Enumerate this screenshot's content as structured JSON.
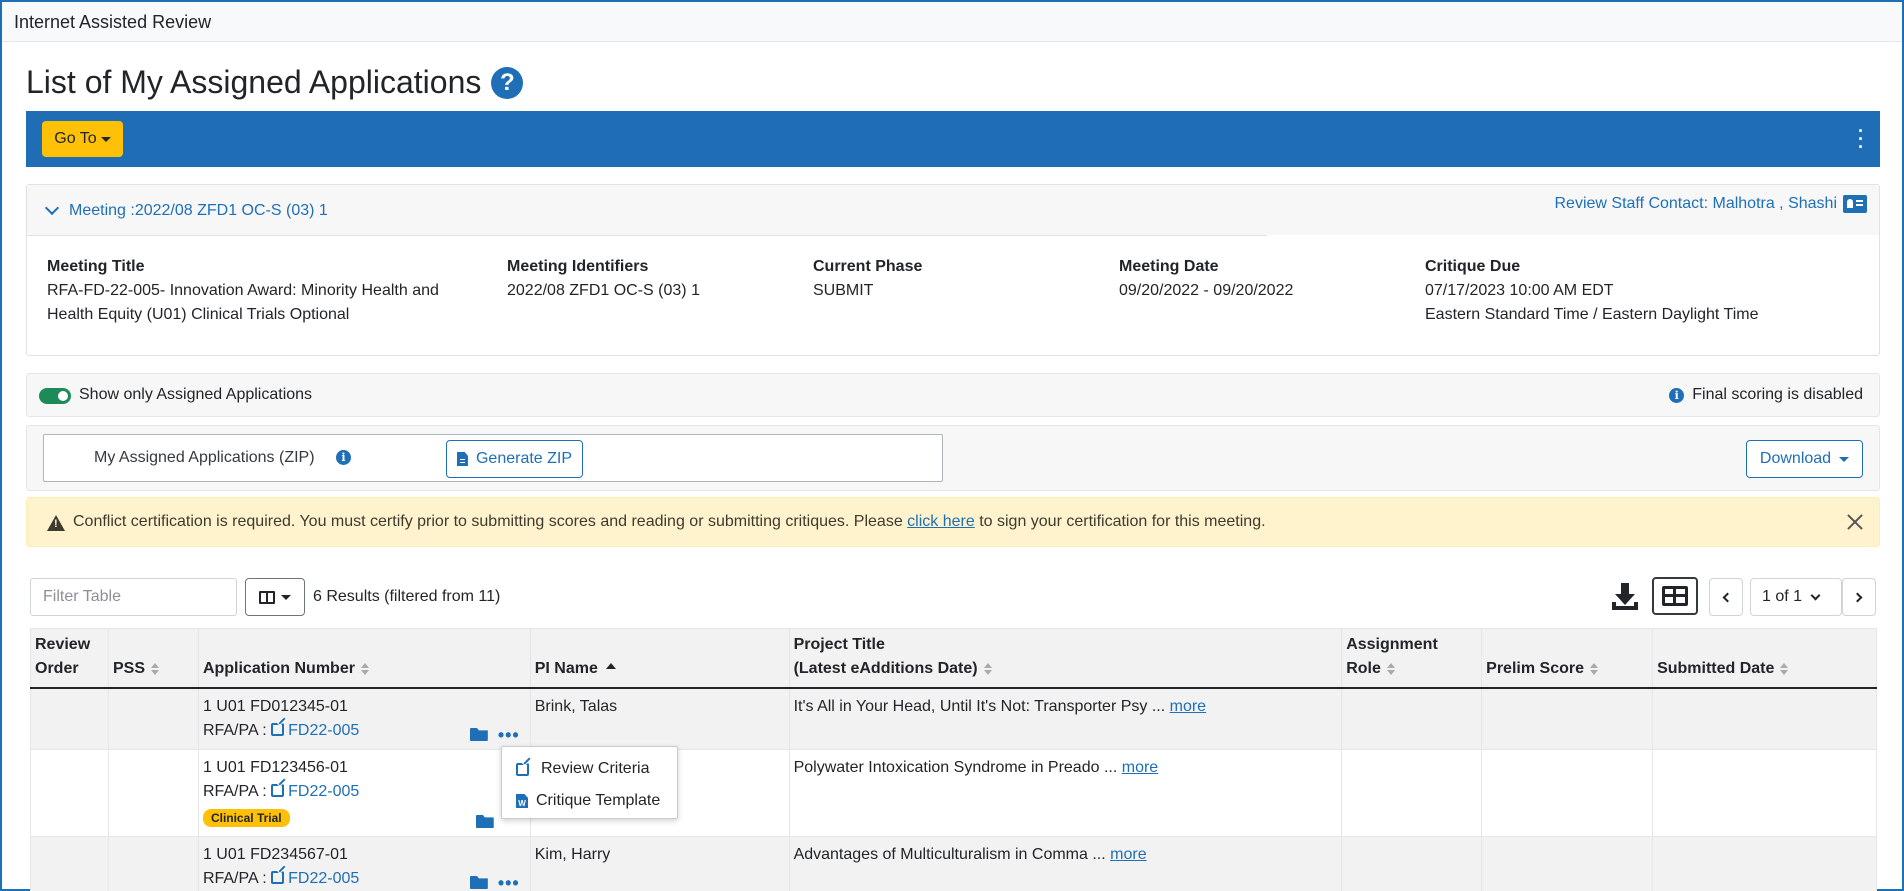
{
  "app": {
    "title": "Internet Assisted Review"
  },
  "page": {
    "title": "List of My Assigned Applications"
  },
  "toolbar": {
    "goto_label": "Go To"
  },
  "meeting": {
    "toggle_label": "Meeting :2022/08 ZFD1 OC-S (03) 1",
    "staff_contact": "Review Staff Contact: Malhotra , Shashi",
    "fields": {
      "title_label": "Meeting Title",
      "title_value_1": "RFA-FD-22-005- Innovation Award: Minority Health and",
      "title_value_2": "Health Equity (U01) Clinical Trials Optional",
      "ident_label": "Meeting Identifiers",
      "ident_value": "2022/08 ZFD1 OC-S (03) 1",
      "phase_label": "Current Phase",
      "phase_value": "SUBMIT",
      "date_label": "Meeting Date",
      "date_value": "09/20/2022 - 09/20/2022",
      "due_label": "Critique Due",
      "due_value_1": "07/17/2023 10:00 AM EDT",
      "due_value_2": "Eastern Standard Time / Eastern Daylight Time"
    }
  },
  "filters": {
    "show_assigned_label": "Show only Assigned Applications",
    "show_assigned_on": true,
    "final_scoring": "Final scoring is disabled"
  },
  "zip": {
    "label": "My Assigned Applications (ZIP)",
    "generate_label": "Generate ZIP",
    "download_label": "Download"
  },
  "alert": {
    "text_before": "Conflict certification is required. You must certify prior to submitting scores and reading or submitting critiques. Please ",
    "link_text": "click here",
    "text_after": " to sign your certification for this meeting."
  },
  "table_controls": {
    "filter_placeholder": "Filter Table",
    "results": "6 Results (filtered from 11)",
    "page_select": "1 of 1"
  },
  "table": {
    "headers": {
      "review_order_1": "Review",
      "review_order_2": "Order",
      "pss": "PSS",
      "app_number": "Application Number",
      "pi_name": "PI Name",
      "project_title_1": "Project Title",
      "project_title_2": "(Latest eAdditions Date)",
      "assignment_role_1": "Assignment",
      "assignment_role_2": "Role",
      "prelim_score": "Prelim Score",
      "submitted_date": "Submitted Date"
    },
    "rows": [
      {
        "app_number": "1 U01 FD012345-01",
        "rfa_prefix": "RFA/PA : ",
        "rfa_link": "FD22-005",
        "badge": "",
        "pi_name": "Brink, Talas",
        "title": "It's All in Your Head, Until It's Not: Transporter Psy",
        "more": "more"
      },
      {
        "app_number": "1 U01 FD123456-01",
        "rfa_prefix": "RFA/PA : ",
        "rfa_link": "FD22-005",
        "badge": "Clinical Trial",
        "pi_name": "",
        "title": "Polywater Intoxication Syndrome in Preado",
        "more": "more"
      },
      {
        "app_number": "1 U01 FD234567-01",
        "rfa_prefix": "RFA/PA : ",
        "rfa_link": "FD22-005",
        "badge": "",
        "pi_name": "Kim, Harry",
        "title": "Advantages of Multiculturalism in Comma",
        "more": "more"
      }
    ]
  },
  "popup_menu": {
    "items": [
      "Review Criteria",
      "Critique Template"
    ]
  },
  "colors": {
    "primary": "#1f6db4",
    "accent": "#ffc107",
    "alert_bg": "#fff3cd",
    "toggle_on": "#1e8a5a"
  },
  "icons": [
    "help-icon",
    "kebab-icon",
    "chevron-down-icon",
    "contact-card-icon",
    "info-icon",
    "file-icon",
    "warning-icon",
    "close-icon",
    "columns-icon",
    "download-icon",
    "table-view-icon",
    "chevron-left-icon",
    "chevron-right-icon",
    "external-link-icon",
    "folder-icon",
    "more-dots-icon",
    "word-doc-icon"
  ]
}
